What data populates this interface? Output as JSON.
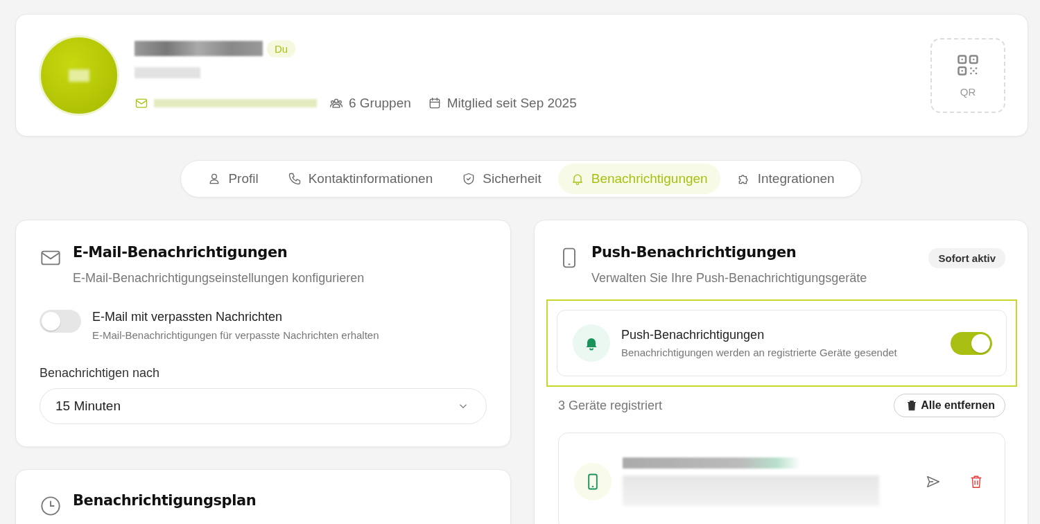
{
  "profile": {
    "badge": "Du",
    "groups": "6 Gruppen",
    "member_since": "Mitglied seit Sep 2025",
    "qr_label": "QR"
  },
  "tabs": [
    {
      "label": "Profil",
      "kind": "person",
      "selected": false
    },
    {
      "label": "Kontaktinformationen",
      "kind": "phone",
      "selected": false
    },
    {
      "label": "Sicherheit",
      "kind": "shield",
      "selected": false
    },
    {
      "label": "Benachrichtigungen",
      "kind": "bell",
      "selected": true
    },
    {
      "label": "Integrationen",
      "kind": "puzzle",
      "selected": false
    }
  ],
  "email_card": {
    "title": "E-Mail-Benachrichtigungen",
    "subtitle": "E-Mail-Benachrichtigungseinstellungen konfigurieren",
    "toggle": {
      "label": "E-Mail mit verpassten Nachrichten",
      "description": "E-Mail-Benachrichtigungen für verpasste Nachrichten erhalten",
      "on": false
    },
    "select_label": "Benachrichtigen nach",
    "select_value": "15 Minuten"
  },
  "schedule_card": {
    "title": "Benachrichtigungsplan"
  },
  "push_card": {
    "title": "Push-Benachrichtigungen",
    "badge": "Sofort aktiv",
    "subtitle": "Verwalten Sie Ihre Push-Benachrichtigungsgeräte",
    "master": {
      "label": "Push-Benachrichtigungen",
      "description": "Benachrichtigungen werden an registrierte Geräte gesendet",
      "on": true
    },
    "device_count": "3 Geräte registriert",
    "remove_all": "Alle entfernen"
  }
}
